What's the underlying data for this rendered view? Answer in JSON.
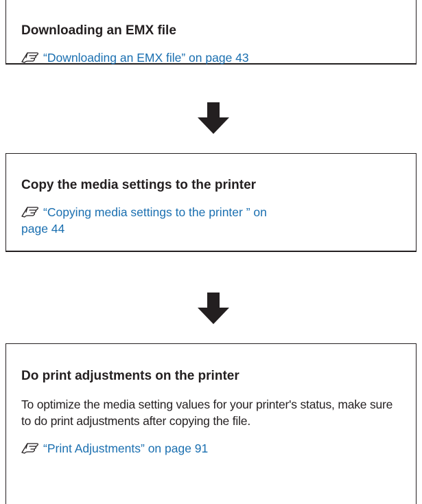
{
  "steps": [
    {
      "title": "Downloading an EMX file",
      "link": "“Downloading an EMX file” on page 43"
    },
    {
      "title": "Copy the media settings to the printer",
      "link_line1": "“Copying media settings to the printer ” on",
      "link_line2": "page 44"
    },
    {
      "title": "Do print adjustments on the printer",
      "body": "To optimize the media setting values for your printer's status, make sure to do print adjustments after copying the file.",
      "link": "“Print Adjustments” on page 91"
    }
  ],
  "icons": {
    "reference": "hand-pointing-reference-icon",
    "flow": "arrow-down-icon"
  },
  "colors": {
    "text": "#231f20",
    "link": "#1a6fb0"
  }
}
